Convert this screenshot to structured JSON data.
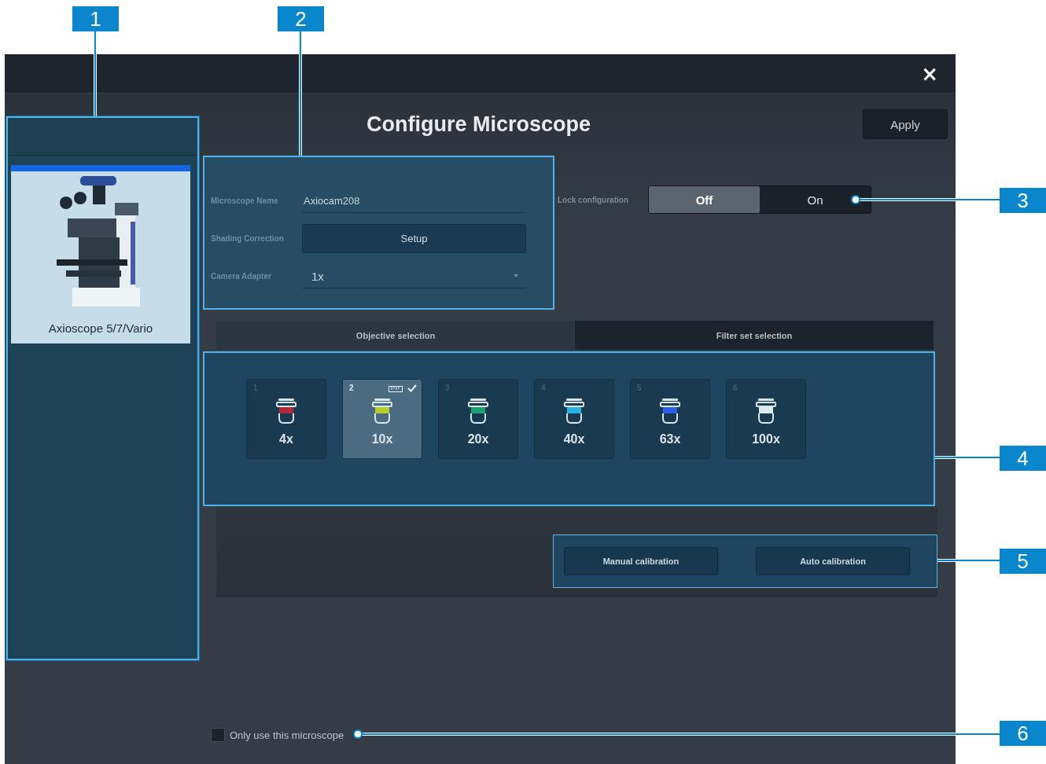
{
  "window": {
    "title": "Configure Microscope",
    "close": "×",
    "apply": "Apply"
  },
  "sidebar": {
    "microscope": "Axioscope 5/7/Vario"
  },
  "settings": {
    "fields": [
      {
        "kind": "text",
        "label": "Microscope Name",
        "value": "Axiocam208"
      },
      {
        "kind": "button",
        "label": "Shading Correction",
        "value": "Setup"
      },
      {
        "kind": "dropdown",
        "label": "Camera Adapter",
        "value": "1x"
      }
    ]
  },
  "lock": {
    "label": "Lock configuration",
    "options": [
      {
        "label": "Off",
        "selected": true
      },
      {
        "label": "On",
        "selected": false
      }
    ]
  },
  "tabs": [
    {
      "label": "Objective selection",
      "selected": true
    },
    {
      "label": "Filter set selection",
      "selected": false
    }
  ],
  "objectives": [
    {
      "number": "1",
      "label": "4x",
      "color": "#b02a3c",
      "selected": false
    },
    {
      "number": "2",
      "label": "10x",
      "color": "#b8cc2c",
      "selected": true
    },
    {
      "number": "3",
      "label": "20x",
      "color": "#1fa070",
      "selected": false
    },
    {
      "number": "4",
      "label": "40x",
      "color": "#2ab4e4",
      "selected": false
    },
    {
      "number": "5",
      "label": "63x",
      "color": "#2a5ee4",
      "selected": false
    },
    {
      "number": "6",
      "label": "100x",
      "color": "#dcecf4",
      "selected": false
    }
  ],
  "calibration": [
    "Manual calibration",
    "Auto calibration"
  ],
  "only_this": {
    "label": "Only use this microscope",
    "checked": false
  },
  "callouts": [
    {
      "number": "1"
    },
    {
      "number": "2"
    },
    {
      "number": "3"
    },
    {
      "number": "4"
    },
    {
      "number": "5"
    },
    {
      "number": "6"
    }
  ]
}
